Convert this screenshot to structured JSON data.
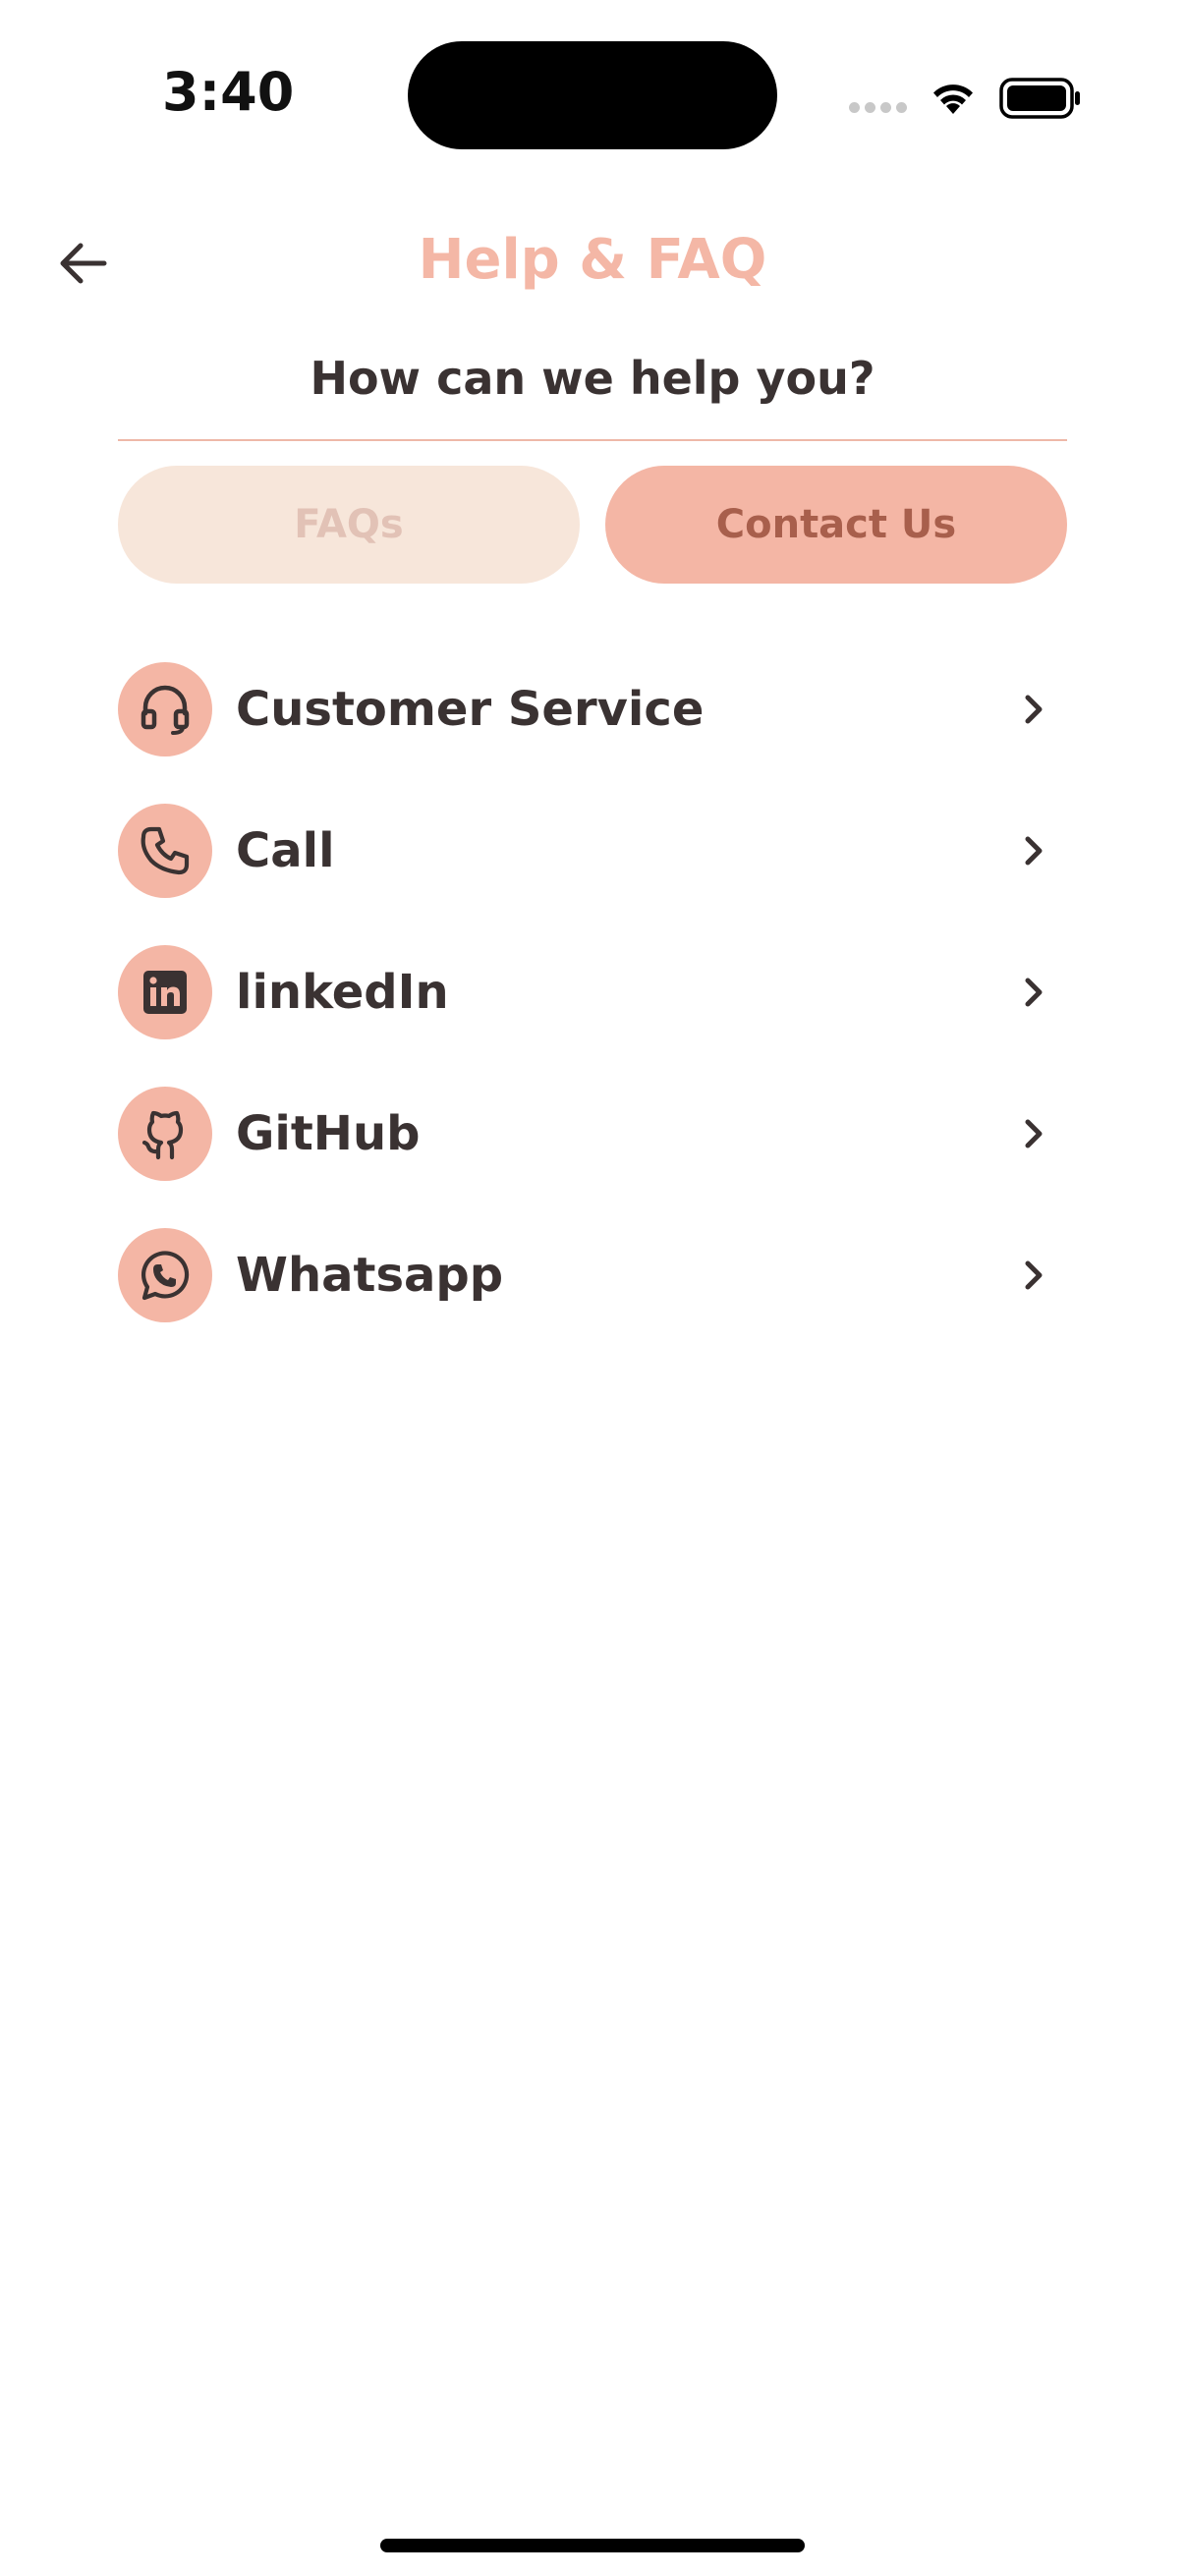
{
  "status_bar": {
    "time": "3:40"
  },
  "header": {
    "title": "Help & FAQ",
    "back_icon": "arrow-left-icon"
  },
  "subtitle": "How can we help you?",
  "tabs": [
    {
      "label": "FAQs",
      "active": false
    },
    {
      "label": "Contact Us",
      "active": true
    }
  ],
  "contacts": [
    {
      "label": "Customer Service",
      "icon": "headset-icon"
    },
    {
      "label": "Call",
      "icon": "phone-icon"
    },
    {
      "label": "linkedIn",
      "icon": "linkedin-icon"
    },
    {
      "label": "GitHub",
      "icon": "github-icon"
    },
    {
      "label": "Whatsapp",
      "icon": "whatsapp-icon"
    }
  ],
  "colors": {
    "accent": "#f4b6a5",
    "title": "#f4b7a6",
    "tab_inactive_bg": "#f7e6da",
    "text_dark": "#3a3232"
  }
}
